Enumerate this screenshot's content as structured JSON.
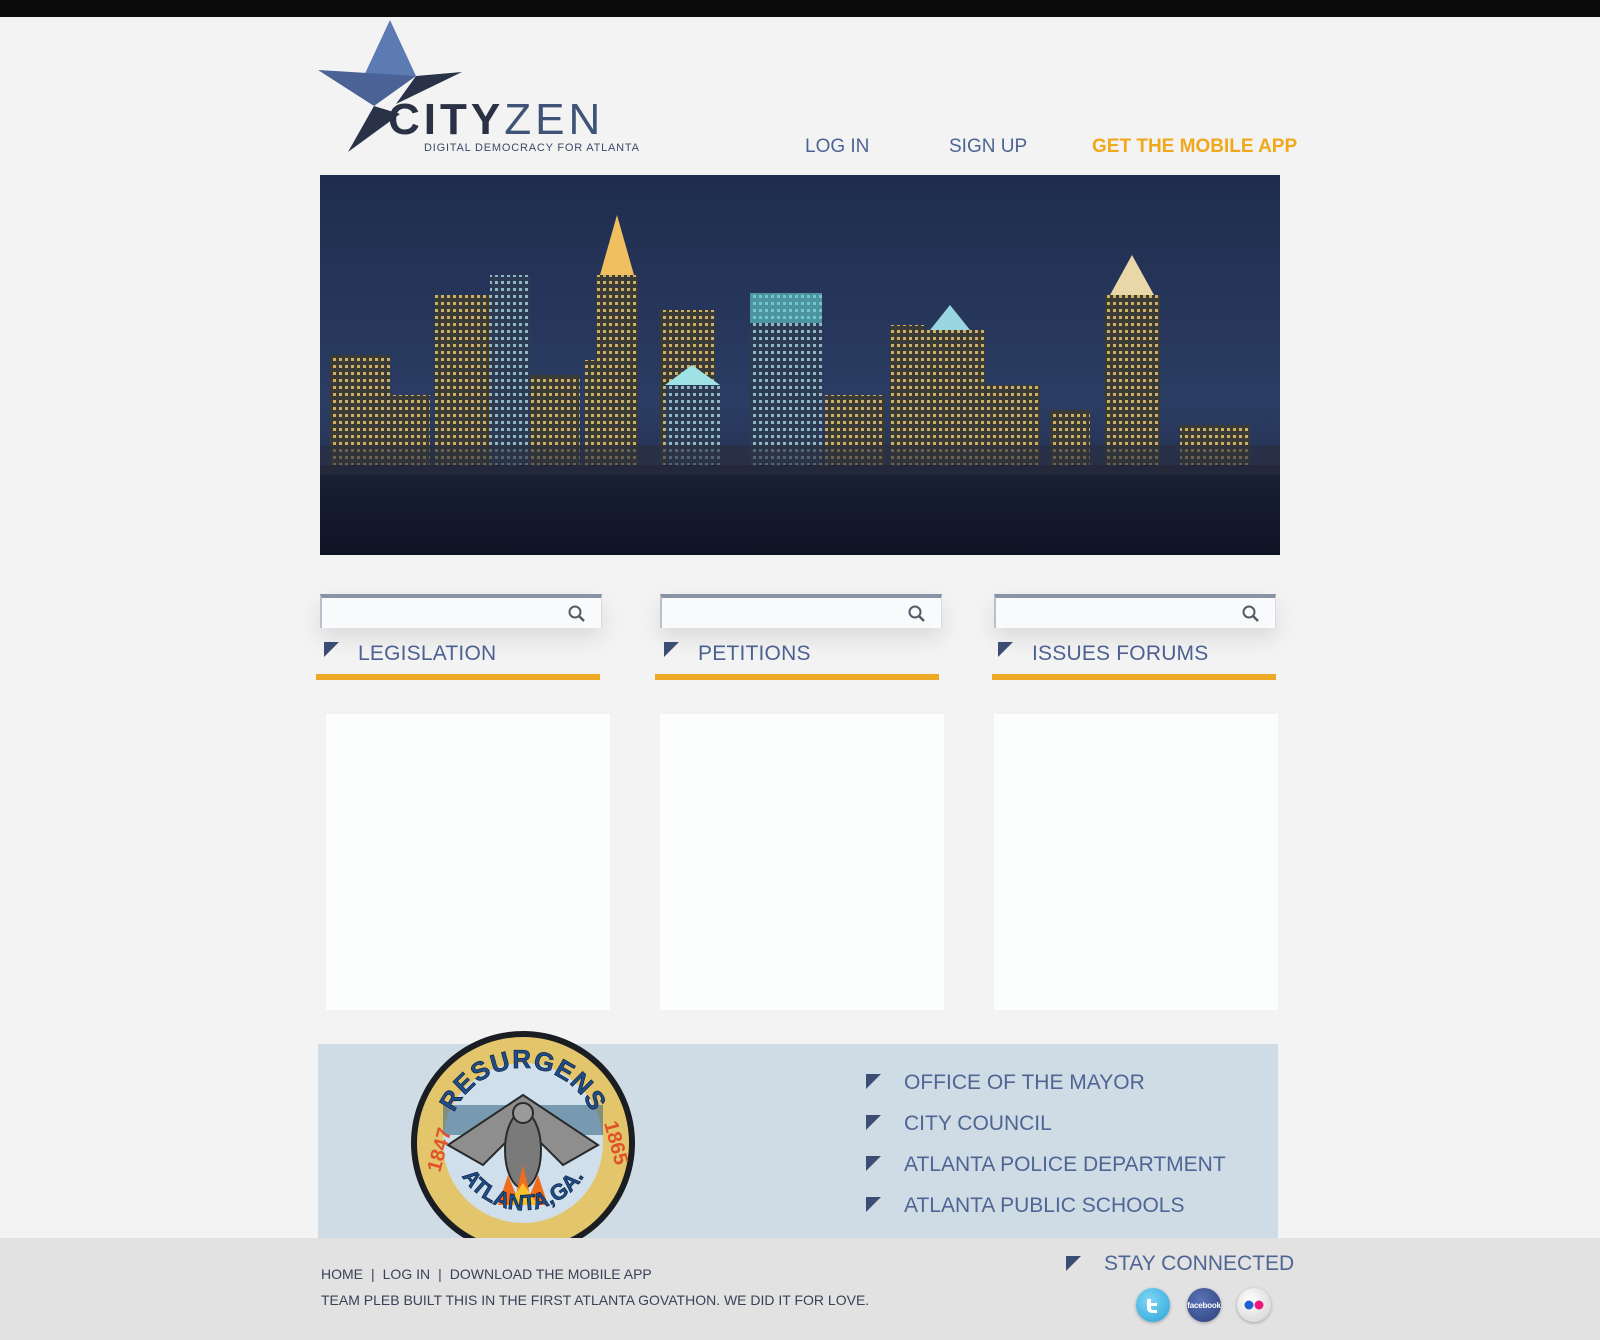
{
  "brand": {
    "name_part1": "CITY",
    "name_part2": "ZEN",
    "tagline": "DIGITAL DEMOCRACY FOR ATLANTA"
  },
  "nav": {
    "login": "LOG IN",
    "signup": "SIGN UP",
    "mobile_app": "GET THE MOBILE APP"
  },
  "colors": {
    "accent": "#f0a81c",
    "brand_blue": "#4b6192",
    "navy": "#2a3144",
    "band": "#cfdbe5"
  },
  "sections": [
    {
      "label": "LEGISLATION",
      "search_placeholder": ""
    },
    {
      "label": "PETITIONS",
      "search_placeholder": ""
    },
    {
      "label": "ISSUES FORUMS",
      "search_placeholder": ""
    }
  ],
  "seal": {
    "top_text": "RESURGENS",
    "bottom_text": "ATLANTA,GA.",
    "year_left": "1847",
    "year_right": "1865"
  },
  "city_links": [
    "OFFICE OF THE MAYOR",
    "CITY COUNCIL",
    "ATLANTA POLICE DEPARTMENT",
    "ATLANTA PUBLIC SCHOOLS"
  ],
  "footer": {
    "links": [
      "HOME",
      "LOG IN",
      "DOWNLOAD THE MOBILE APP"
    ],
    "separator": "|",
    "credit": "TEAM PLEB BUILT THIS IN THE FIRST ATLANTA GOVATHON. WE DID IT FOR LOVE.",
    "stay_connected": "STAY CONNECTED",
    "social": [
      {
        "name": "twitter",
        "icon": "twitter-icon"
      },
      {
        "name": "facebook",
        "icon": "facebook-icon",
        "text": "facebook"
      },
      {
        "name": "flickr",
        "icon": "flickr-icon"
      }
    ]
  }
}
